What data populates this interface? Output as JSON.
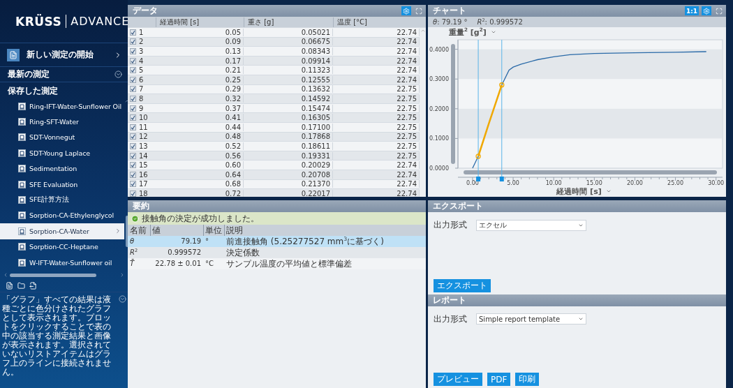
{
  "sidebar": {
    "logo_brand": "KRÜSS",
    "logo_product": "ADVANCE",
    "new_measurement": "新しい測定の開始",
    "recent_label": "最新の測定",
    "saved_label": "保存した測定",
    "saved_items": [
      {
        "name": "Ring-IFT-Water-Sunflower Oil",
        "selected": false
      },
      {
        "name": "Ring-SFT-Water",
        "selected": false
      },
      {
        "name": "SDT-Vonnegut",
        "selected": false
      },
      {
        "name": "SDT-Young Laplace",
        "selected": false
      },
      {
        "name": "Sedimentation",
        "selected": false
      },
      {
        "name": "SFE Evaluation",
        "selected": false
      },
      {
        "name": "SFE計算方法",
        "selected": false
      },
      {
        "name": "Sorption-CA-Ethylenglycol",
        "selected": false
      },
      {
        "name": "Sorption-CA-Water",
        "selected": true
      },
      {
        "name": "Sorption-CC-Heptane",
        "selected": false
      },
      {
        "name": "W-IFT-Water-Sunflower oil",
        "selected": false
      }
    ],
    "help_text": "「グラフ」すべての結果は液種ごとに色分けされたグラフとして表示されます。プロットをクリックすることで表の中の該当する測定結果と画像が表示されます。選択されていないリストアイテムはグラフ上のラインに接続されません。"
  },
  "data_panel": {
    "title": "データ",
    "columns": [
      "経過時間 [s]",
      "重さ [g]",
      "温度 [°C]"
    ],
    "rows": [
      {
        "checked": true,
        "index": "1",
        "cells": [
          "0.05",
          "0.05021",
          "22.74"
        ]
      },
      {
        "checked": true,
        "index": "2",
        "cells": [
          "0.09",
          "0.06675",
          "22.74"
        ]
      },
      {
        "checked": true,
        "index": "3",
        "cells": [
          "0.13",
          "0.08343",
          "22.74"
        ]
      },
      {
        "checked": true,
        "index": "4",
        "cells": [
          "0.17",
          "0.09914",
          "22.74"
        ]
      },
      {
        "checked": true,
        "index": "5",
        "cells": [
          "0.21",
          "0.11323",
          "22.74"
        ]
      },
      {
        "checked": true,
        "index": "6",
        "cells": [
          "0.25",
          "0.12555",
          "22.74"
        ]
      },
      {
        "checked": true,
        "index": "7",
        "cells": [
          "0.29",
          "0.13632",
          "22.75"
        ]
      },
      {
        "checked": true,
        "index": "8",
        "cells": [
          "0.32",
          "0.14592",
          "22.75"
        ]
      },
      {
        "checked": true,
        "index": "9",
        "cells": [
          "0.37",
          "0.15474",
          "22.75"
        ]
      },
      {
        "checked": true,
        "index": "10",
        "cells": [
          "0.41",
          "0.16305",
          "22.75"
        ]
      },
      {
        "checked": true,
        "index": "11",
        "cells": [
          "0.44",
          "0.17100",
          "22.75"
        ]
      },
      {
        "checked": true,
        "index": "12",
        "cells": [
          "0.48",
          "0.17868",
          "22.75"
        ]
      },
      {
        "checked": true,
        "index": "13",
        "cells": [
          "0.52",
          "0.18611",
          "22.75"
        ]
      },
      {
        "checked": true,
        "index": "14",
        "cells": [
          "0.56",
          "0.19331",
          "22.75"
        ]
      },
      {
        "checked": true,
        "index": "15",
        "cells": [
          "0.60",
          "0.20029",
          "22.74"
        ]
      },
      {
        "checked": true,
        "index": "16",
        "cells": [
          "0.64",
          "0.20708",
          "22.74"
        ]
      },
      {
        "checked": true,
        "index": "17",
        "cells": [
          "0.68",
          "0.21370",
          "22.74"
        ]
      },
      {
        "checked": true,
        "index": "18",
        "cells": [
          "0.72",
          "0.22017",
          "22.74"
        ]
      }
    ]
  },
  "chart_panel": {
    "title": "チャート",
    "zoom_button": "1:1",
    "stats": [
      "*θ*: 79.19 °",
      "*R*$^{2}$: 0.999572"
    ],
    "chart_data": {
      "type": "line",
      "ylabel": "重量$^{2}$ [g$^{2}$]",
      "xlabel": "経過時間 [s]",
      "x": [
        0,
        0.7,
        2,
        3.6,
        4.5,
        5,
        6,
        8,
        10,
        12,
        15,
        20,
        25,
        28.8
      ],
      "series": [
        {
          "color": "#2a6aa8",
          "values": [
            0,
            0.04,
            null,
            0.28,
            0.33,
            0.34,
            0.35,
            0.365,
            0.375,
            0.382,
            0.386,
            0.388,
            0.39,
            0.392
          ]
        },
        {
          "color": "#f0a800",
          "values": [
            null,
            0.04,
            0.15,
            0.28,
            null,
            null,
            null,
            null,
            null,
            null,
            null,
            null,
            null,
            null
          ]
        }
      ],
      "ref_lines": [
        {
          "axis": "x",
          "value": 0.7
        },
        {
          "axis": "x",
          "value": 3.6
        }
      ],
      "xlim": [
        -1.8,
        30.8
      ],
      "ylim": [
        0,
        0.432
      ],
      "xticks": [
        {
          "value": 0,
          "label": "0.00"
        },
        {
          "value": 5,
          "label": "5.00"
        },
        {
          "value": 10,
          "label": "10.00"
        },
        {
          "value": 15,
          "label": "15.00"
        },
        {
          "value": 20,
          "label": "20.00"
        },
        {
          "value": 25,
          "label": "25.00"
        },
        {
          "value": 30,
          "label": "30.00"
        }
      ],
      "yticks": [
        {
          "value": 0,
          "label": "0.0000"
        },
        {
          "value": 0.1,
          "label": "0.1000"
        },
        {
          "value": 0.2,
          "label": "0.2000"
        },
        {
          "value": 0.3,
          "label": "0.3000"
        },
        {
          "value": 0.4,
          "label": "0.4000"
        }
      ]
    }
  },
  "summary_panel": {
    "title": "要約",
    "status": "接触角の決定が成功しました。",
    "columns": [
      "名前",
      "値",
      "単位",
      "説明"
    ],
    "rows": [
      {
        "name": "*θ*",
        "value": "79.19",
        "unit": "°",
        "description": "前進接触角 (5.25277527 mm$^{3}$に基づく)",
        "selected": true
      },
      {
        "name": "*R*$^{2}$",
        "value": "0.999572",
        "description": "決定係数",
        "selected": false
      },
      {
        "name": "*T̄*",
        "value": "22.78 ± 0.01",
        "unit": "°C",
        "description": "サンプル温度の平均値と標準偏差",
        "selected": false
      }
    ]
  },
  "export_panel": {
    "title": "エクスポート",
    "format_label": "出力形式",
    "format_value": "エクセル",
    "button": "エクスポート"
  },
  "report_panel": {
    "title": "レポート",
    "format_label": "出力形式",
    "format_value": "Simple report template",
    "buttons": [
      "プレビュー",
      "PDF",
      "印刷"
    ]
  }
}
